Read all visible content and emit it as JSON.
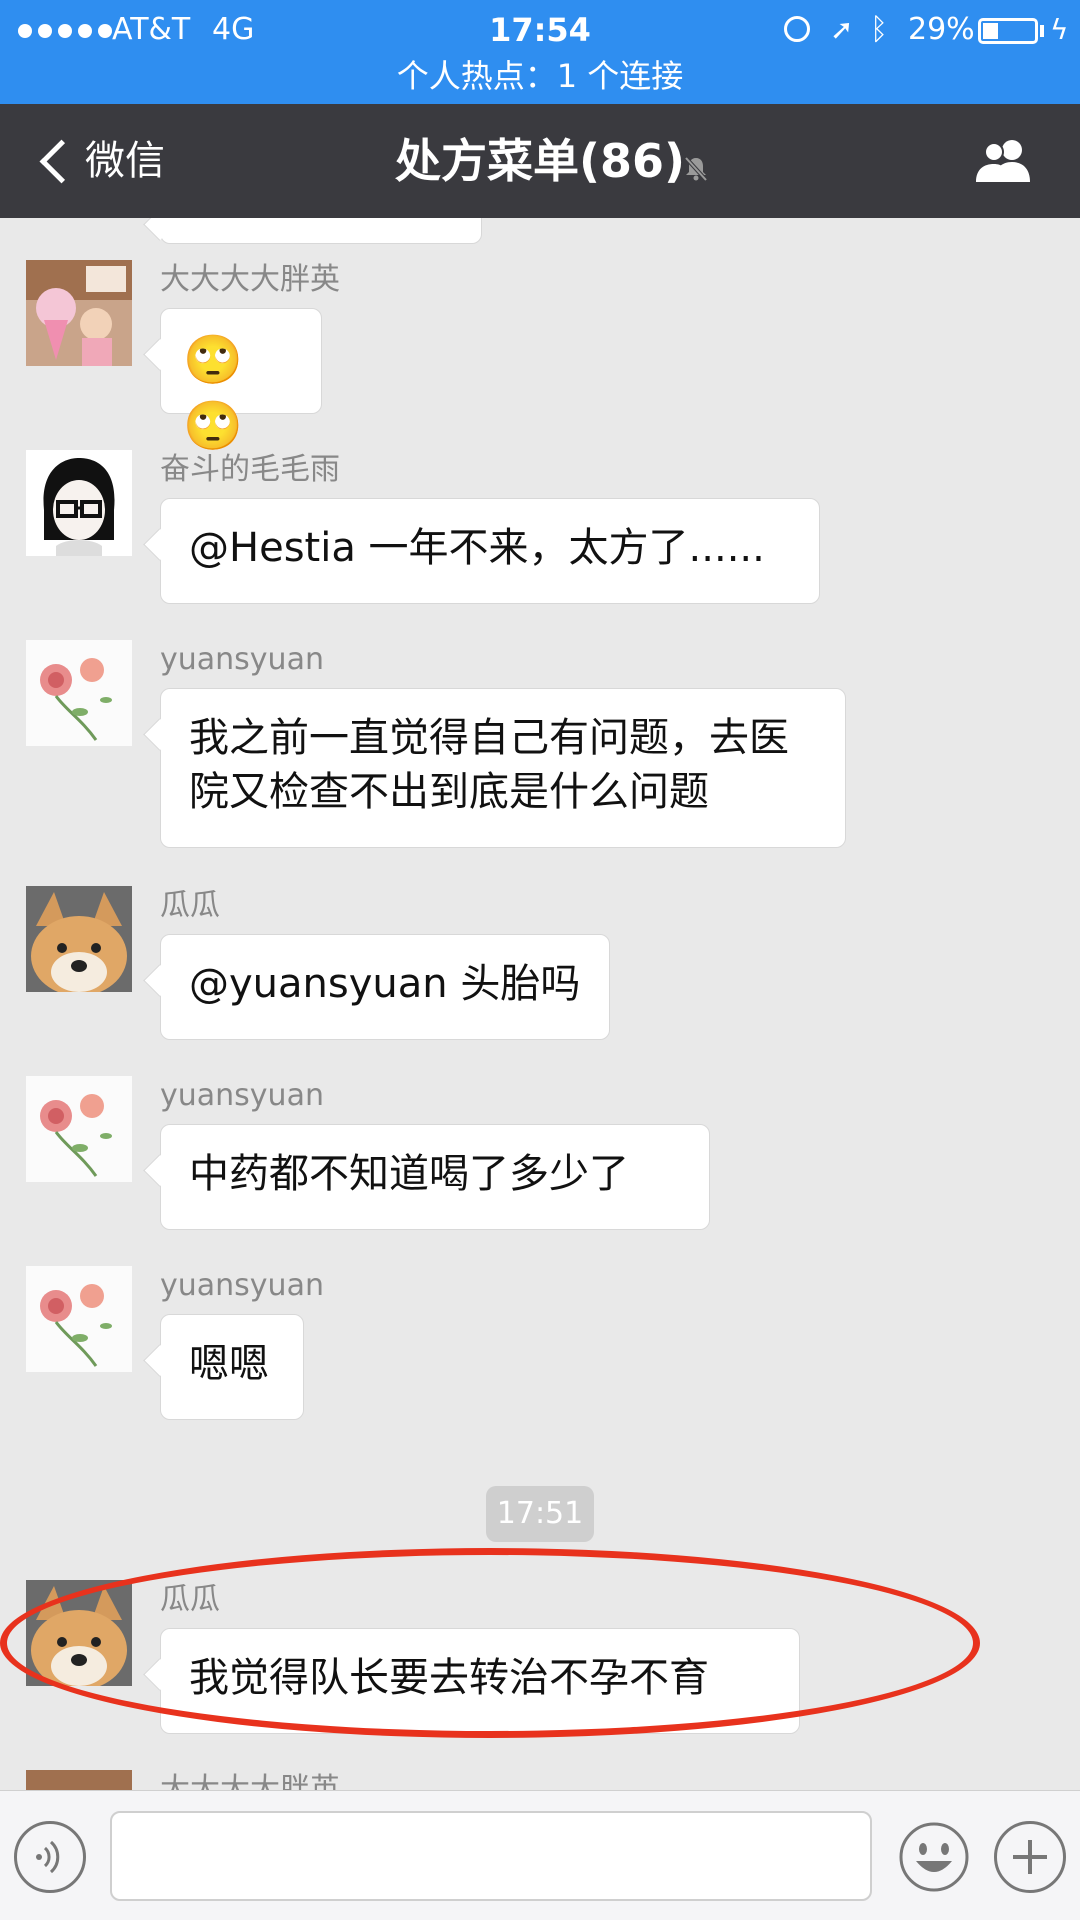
{
  "status_bar": {
    "carrier": "AT&T",
    "network": "4G",
    "time": "17:54",
    "battery": "29%",
    "battery_level": 0.29,
    "icons": [
      "signal-dots-icon",
      "rotation-lock-icon",
      "location-arrow-icon",
      "bluetooth-icon",
      "battery-icon",
      "charging-bolt-icon"
    ]
  },
  "hotspot_banner": "个人热点：1 个连接",
  "nav": {
    "back_label": "微信",
    "title": "处方菜单(86)",
    "icons": [
      "back-chevron-icon",
      "mute-bell-icon",
      "group-members-icon"
    ]
  },
  "messages": [
    {
      "sender": "大大大大胖英",
      "text": "🙄🙄",
      "avatar": "cupcake-girl-avatar"
    },
    {
      "sender": "奋斗的毛毛雨",
      "text": "@Hestia 一年不来，太方了......",
      "avatar": "glasses-girl-avatar"
    },
    {
      "sender": "yuansyuan",
      "text": "我之前一直觉得自己有问题，去医院又检查不出到底是什么问题",
      "avatar": "rose-avatar"
    },
    {
      "sender": "瓜瓜",
      "text": "@yuansyuan 头胎吗",
      "avatar": "shiba-dog-avatar"
    },
    {
      "sender": "yuansyuan",
      "text": "中药都不知道喝了多少了",
      "avatar": "rose-avatar"
    },
    {
      "sender": "yuansyuan",
      "text": "嗯嗯",
      "avatar": "rose-avatar"
    },
    {
      "sender": "瓜瓜",
      "text": "我觉得队长要去转治不孕不育",
      "avatar": "shiba-dog-avatar"
    },
    {
      "sender": "大大大大胖英",
      "text": "",
      "avatar": "cupcake-girl-avatar"
    }
  ],
  "timestamp": "17:51",
  "annotation": {
    "color": "#e8321d"
  },
  "input_bar": {
    "placeholder": "",
    "icons": [
      "voice-icon",
      "emoji-icon",
      "plus-icon"
    ]
  },
  "colors": {
    "status_bar": "#2f8ef0",
    "nav_bar": "#3a3a3f",
    "chat_background": "#e9e9e9"
  }
}
